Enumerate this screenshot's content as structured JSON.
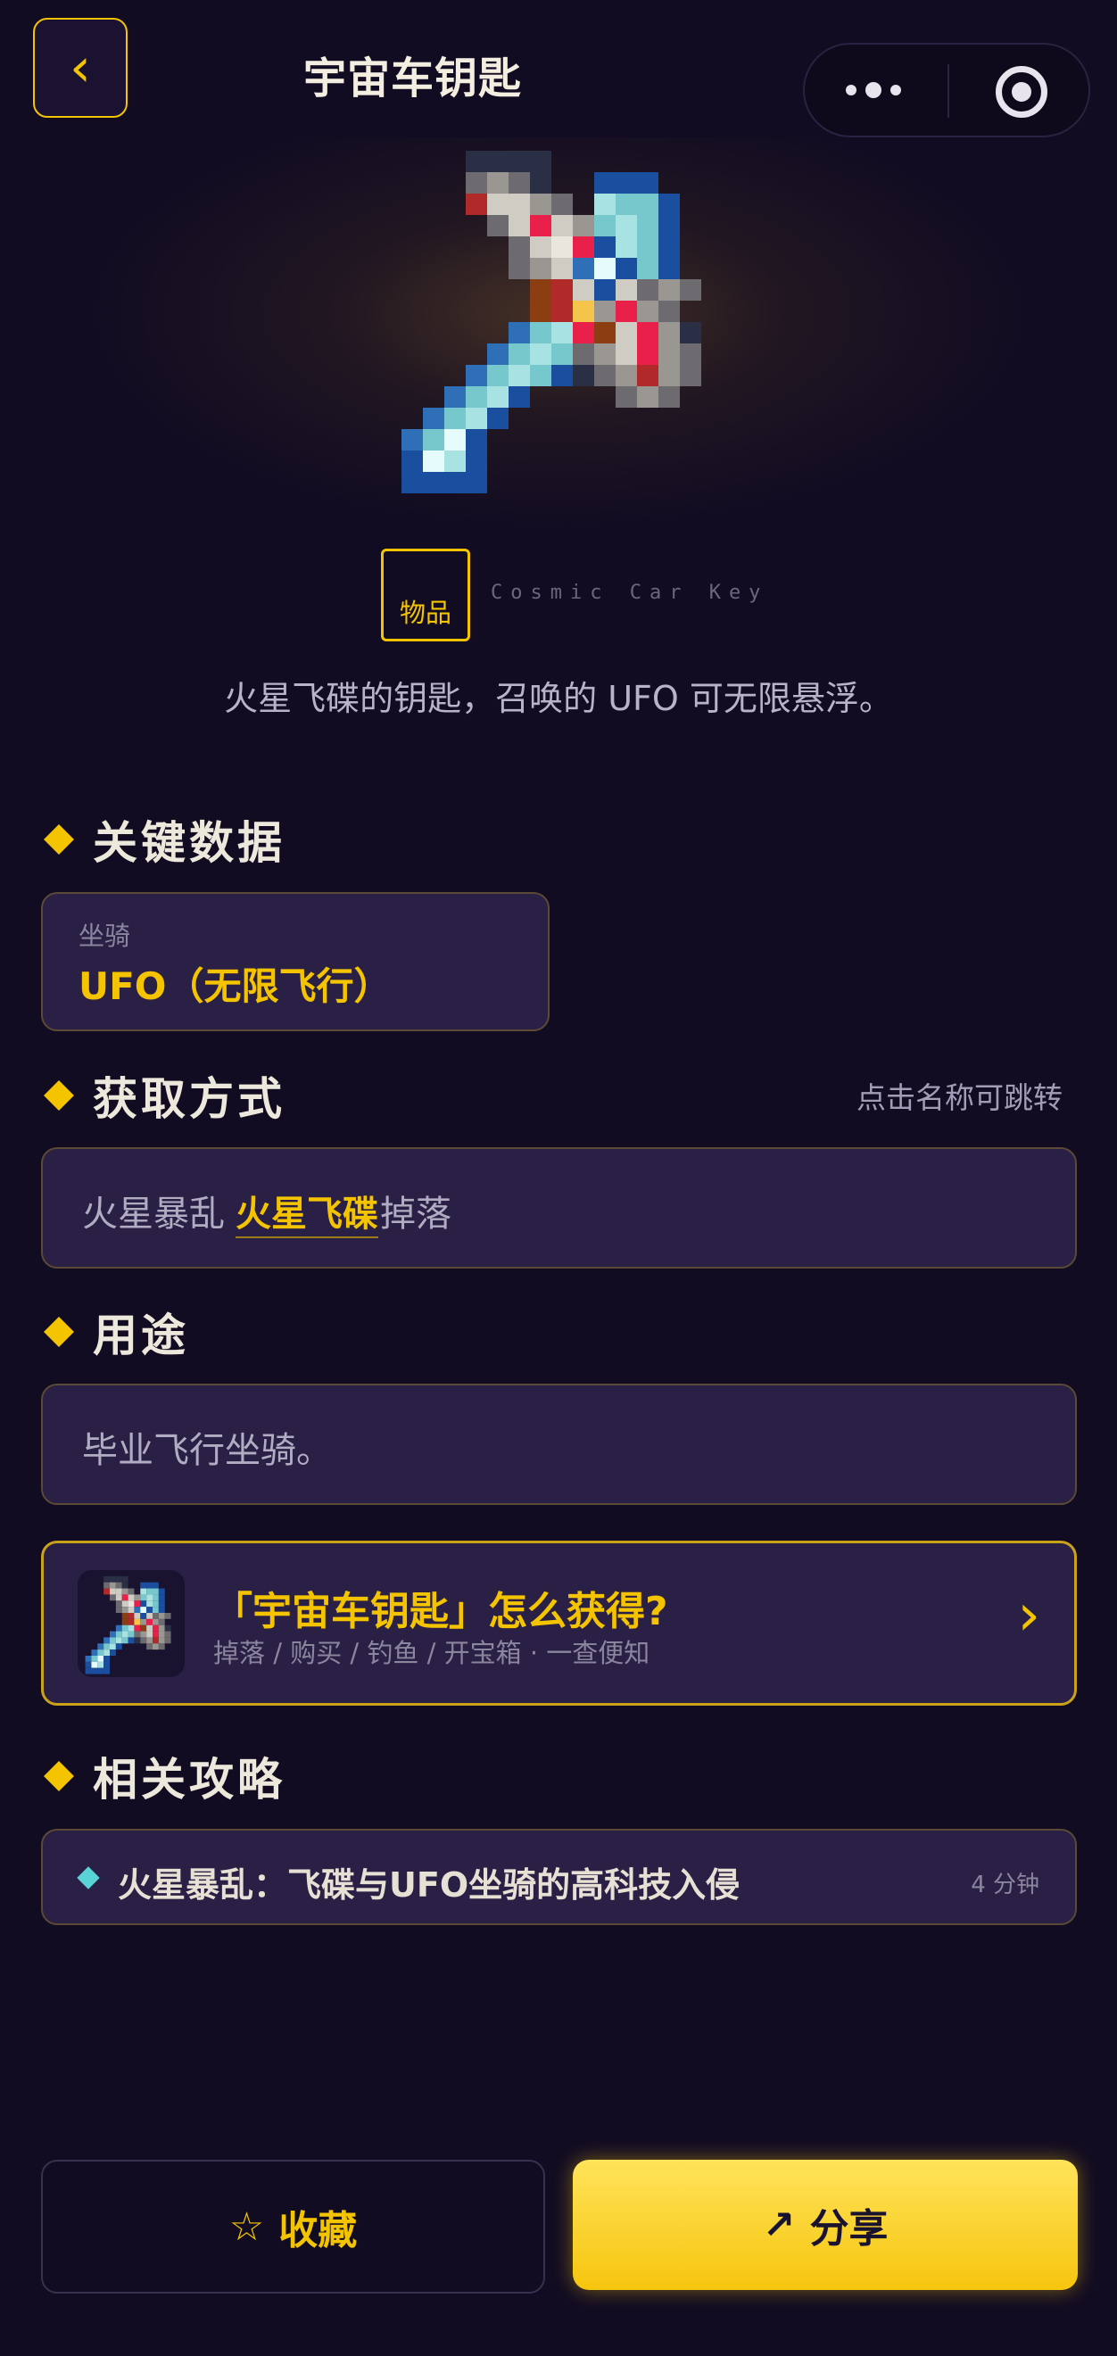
{
  "header": {
    "back_icon": "‹",
    "title": "宇宙车钥匙"
  },
  "item": {
    "type_badge": "物品",
    "english_name": "Cosmic Car Key",
    "description": "火星飞碟的钥匙，召唤的 UFO 可无限悬浮。"
  },
  "key_data": {
    "heading": "关键数据",
    "stat_label": "坐骑",
    "stat_value": "UFO（无限飞行）"
  },
  "acquisition": {
    "heading": "获取方式",
    "hint": "点击名称可跳转",
    "prefix": "火星暴乱",
    "link": "火星飞碟",
    "suffix": "掉落"
  },
  "usage": {
    "heading": "用途",
    "text": "毕业飞行坐骑。"
  },
  "guide_banner": {
    "title": "「宇宙车钥匙」怎么获得?",
    "subtitle": "掉落 / 购买 / 钓鱼 / 开宝箱 · 一查便知",
    "chevron": "›"
  },
  "related": {
    "heading": "相关攻略",
    "items": [
      {
        "title": "火星暴乱：飞碟与UFO坐骑的高科技入侵",
        "time": "4 分钟"
      }
    ]
  },
  "bottom_bar": {
    "favorite_icon": "☆",
    "favorite_label": "收藏",
    "share_icon": "↗",
    "share_label": "分享"
  },
  "colors": {
    "background": "#120c22",
    "accent": "#f5c400",
    "card": "#2a1f44",
    "muted_text": "#8c859e"
  }
}
